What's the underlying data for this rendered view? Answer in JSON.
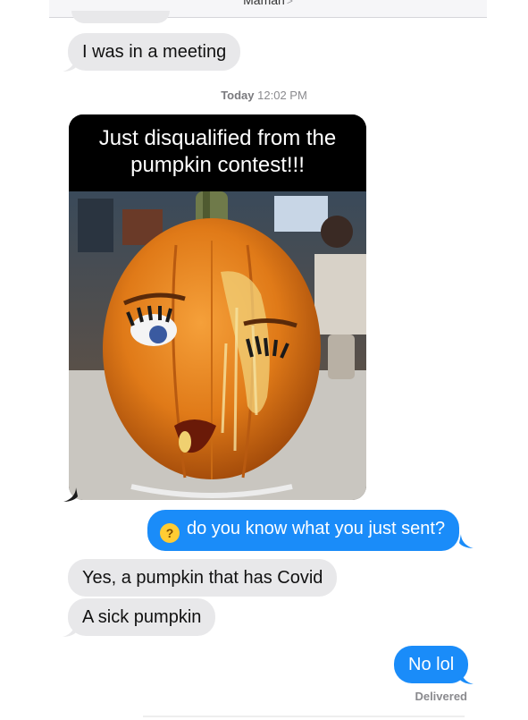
{
  "header": {
    "contact_name": "Maman",
    "chevron": ">"
  },
  "messages": [
    {
      "direction": "incoming",
      "text": "I was in a meeting"
    },
    {
      "type": "timestamp",
      "day": "Today",
      "time": "12:02 PM"
    },
    {
      "direction": "incoming",
      "type": "image",
      "caption_line1": "Just disqualified from the",
      "caption_line2": "pumpkin contest!!!"
    },
    {
      "direction": "outgoing",
      "emoji": "thinking-face",
      "text": "do you know what you just sent?"
    },
    {
      "direction": "incoming",
      "text": "Yes, a pumpkin that has Covid"
    },
    {
      "direction": "incoming",
      "text": "A sick pumpkin"
    },
    {
      "direction": "outgoing",
      "text": "No lol"
    }
  ],
  "status": {
    "delivered": "Delivered"
  },
  "colors": {
    "incoming_bubble": "#e8e8ea",
    "outgoing_bubble": "#1a8cf9",
    "timestamp_text": "#8a8a8e"
  }
}
